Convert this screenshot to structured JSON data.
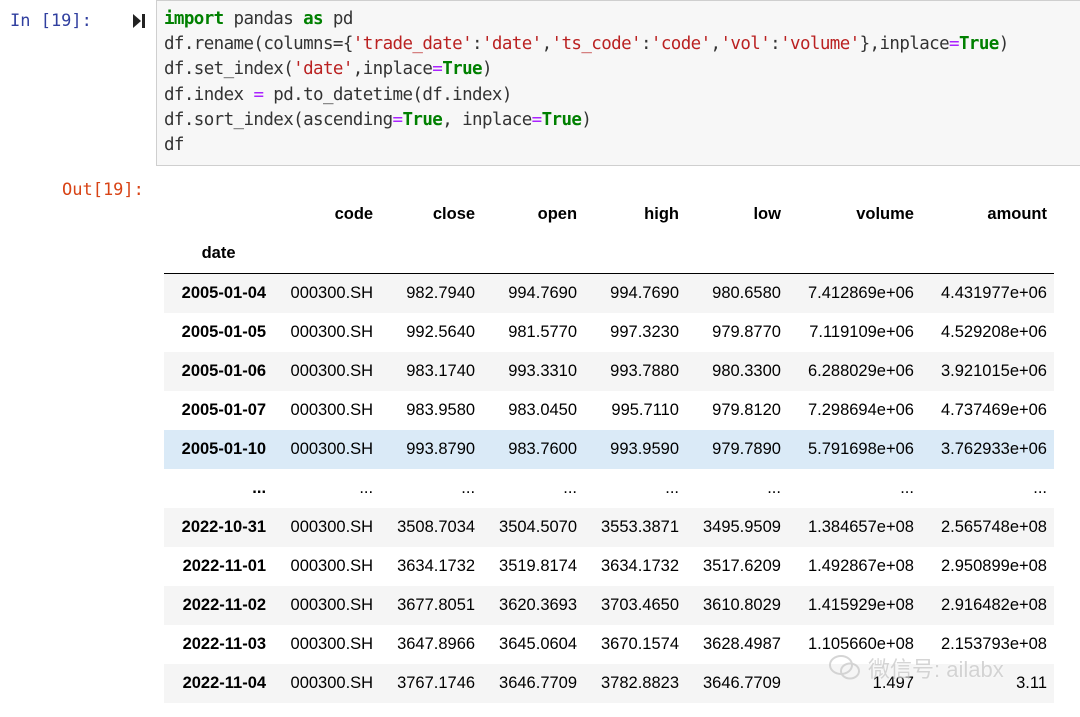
{
  "input_cell": {
    "prompt": "In  [19]:",
    "code_lines": [
      [
        {
          "t": "import",
          "c": "kw"
        },
        {
          "t": " pandas ",
          "c": ""
        },
        {
          "t": "as",
          "c": "kw"
        },
        {
          "t": " pd",
          "c": ""
        }
      ],
      [
        {
          "t": "df.rename(columns={",
          "c": ""
        },
        {
          "t": "'trade_date'",
          "c": "str"
        },
        {
          "t": ":",
          "c": ""
        },
        {
          "t": "'date'",
          "c": "str"
        },
        {
          "t": ",",
          "c": ""
        },
        {
          "t": "'ts_code'",
          "c": "str"
        },
        {
          "t": ":",
          "c": ""
        },
        {
          "t": "'code'",
          "c": "str"
        },
        {
          "t": ",",
          "c": ""
        },
        {
          "t": "'vol'",
          "c": "str"
        },
        {
          "t": ":",
          "c": ""
        },
        {
          "t": "'volume'",
          "c": "str"
        },
        {
          "t": "},inplace",
          "c": ""
        },
        {
          "t": "=",
          "c": "op"
        },
        {
          "t": "True",
          "c": "kw"
        },
        {
          "t": ")",
          "c": ""
        }
      ],
      [
        {
          "t": "df.set_index(",
          "c": ""
        },
        {
          "t": "'date'",
          "c": "str"
        },
        {
          "t": ",inplace",
          "c": ""
        },
        {
          "t": "=",
          "c": "op"
        },
        {
          "t": "True",
          "c": "kw"
        },
        {
          "t": ")",
          "c": ""
        }
      ],
      [
        {
          "t": "df.index ",
          "c": ""
        },
        {
          "t": "=",
          "c": "op"
        },
        {
          "t": " pd.to_datetime(df.index)",
          "c": ""
        }
      ],
      [
        {
          "t": "df.sort_index(ascending",
          "c": ""
        },
        {
          "t": "=",
          "c": "op"
        },
        {
          "t": "True",
          "c": "kw"
        },
        {
          "t": ", inplace",
          "c": ""
        },
        {
          "t": "=",
          "c": "op"
        },
        {
          "t": "True",
          "c": "kw"
        },
        {
          "t": ")",
          "c": ""
        }
      ],
      [
        {
          "t": "df",
          "c": ""
        }
      ]
    ]
  },
  "output_cell": {
    "prompt": "Out[19]:",
    "index_name": "date",
    "columns": [
      "code",
      "close",
      "open",
      "high",
      "low",
      "volume",
      "amount"
    ],
    "rows": [
      {
        "index": "2005-01-04",
        "values": [
          "000300.SH",
          "982.7940",
          "994.7690",
          "994.7690",
          "980.6580",
          "7.412869e+06",
          "4.431977e+06"
        ]
      },
      {
        "index": "2005-01-05",
        "values": [
          "000300.SH",
          "992.5640",
          "981.5770",
          "997.3230",
          "979.8770",
          "7.119109e+06",
          "4.529208e+06"
        ]
      },
      {
        "index": "2005-01-06",
        "values": [
          "000300.SH",
          "983.1740",
          "993.3310",
          "993.7880",
          "980.3300",
          "6.288029e+06",
          "3.921015e+06"
        ]
      },
      {
        "index": "2005-01-07",
        "values": [
          "000300.SH",
          "983.9580",
          "983.0450",
          "995.7110",
          "979.8120",
          "7.298694e+06",
          "4.737469e+06"
        ]
      },
      {
        "index": "2005-01-10",
        "values": [
          "000300.SH",
          "993.8790",
          "983.7600",
          "993.9590",
          "979.7890",
          "5.791698e+06",
          "3.762933e+06"
        ],
        "highlight": true
      },
      {
        "index": "...",
        "values": [
          "...",
          "...",
          "...",
          "...",
          "...",
          "...",
          "..."
        ],
        "ellipsis": true
      },
      {
        "index": "2022-10-31",
        "values": [
          "000300.SH",
          "3508.7034",
          "3504.5070",
          "3553.3871",
          "3495.9509",
          "1.384657e+08",
          "2.565748e+08"
        ]
      },
      {
        "index": "2022-11-01",
        "values": [
          "000300.SH",
          "3634.1732",
          "3519.8174",
          "3634.1732",
          "3517.6209",
          "1.492867e+08",
          "2.950899e+08"
        ]
      },
      {
        "index": "2022-11-02",
        "values": [
          "000300.SH",
          "3677.8051",
          "3620.3693",
          "3703.4650",
          "3610.8029",
          "1.415929e+08",
          "2.916482e+08"
        ]
      },
      {
        "index": "2022-11-03",
        "values": [
          "000300.SH",
          "3647.8966",
          "3645.0604",
          "3670.1574",
          "3628.4987",
          "1.105660e+08",
          "2.153793e+08"
        ]
      },
      {
        "index": "2022-11-04",
        "values": [
          "000300.SH",
          "3767.1746",
          "3646.7709",
          "3782.8823",
          "3646.7709",
          "1.497",
          "3.11"
        ]
      }
    ]
  },
  "watermark": {
    "text": "微信号: ailabx"
  },
  "colors": {
    "in_prompt": "#303f9f",
    "out_prompt": "#d84315",
    "highlight_row": "#daeaf7"
  }
}
